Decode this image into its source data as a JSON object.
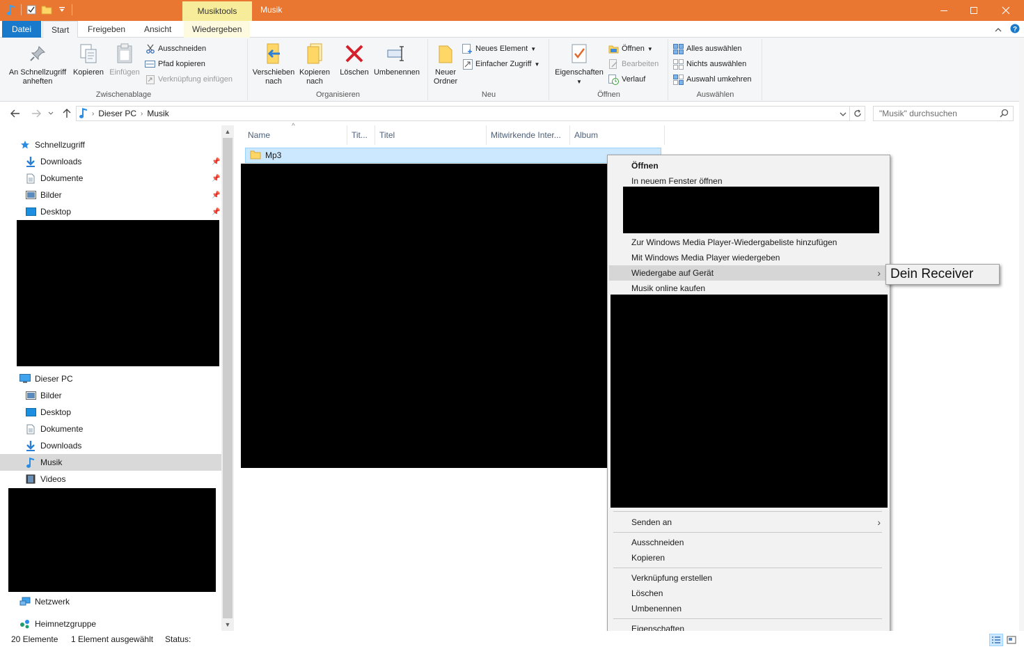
{
  "window": {
    "title": "Musik",
    "contextual_tab_header": "Musiktools",
    "accent": "#e97631",
    "file_tab_color": "#1979ca"
  },
  "ribbon_tabs": [
    "Datei",
    "Start",
    "Freigeben",
    "Ansicht",
    "Wiedergeben"
  ],
  "ribbon": {
    "clipboard": {
      "label": "Zwischenablage",
      "pin": "An Schnellzugriff\nanheften",
      "copy": "Kopieren",
      "paste": "Einfügen",
      "cut": "Ausschneiden",
      "copy_path": "Pfad kopieren",
      "paste_shortcut": "Verknüpfung einfügen"
    },
    "organize": {
      "label": "Organisieren",
      "move": "Verschieben\nnach",
      "copy_to": "Kopieren\nnach",
      "delete": "Löschen",
      "rename": "Umbenennen"
    },
    "new": {
      "label": "Neu",
      "new_folder": "Neuer\nOrdner",
      "new_item": "Neues Element",
      "easy_access": "Einfacher Zugriff"
    },
    "open": {
      "label": "Öffnen",
      "properties": "Eigenschaften",
      "open": "Öffnen",
      "edit": "Bearbeiten",
      "history": "Verlauf"
    },
    "select": {
      "label": "Auswählen",
      "select_all": "Alles auswählen",
      "select_none": "Nichts auswählen",
      "invert": "Auswahl umkehren"
    }
  },
  "address": {
    "crumbs": [
      "Dieser PC",
      "Musik"
    ],
    "search_placeholder": "\"Musik\" durchsuchen"
  },
  "nav": {
    "quick_access": "Schnellzugriff",
    "quick_items": [
      "Downloads",
      "Dokumente",
      "Bilder",
      "Desktop"
    ],
    "this_pc": "Dieser PC",
    "pc_items": [
      "Bilder",
      "Desktop",
      "Dokumente",
      "Downloads",
      "Musik",
      "Videos"
    ],
    "network": "Netzwerk",
    "homegroup": "Heimnetzgruppe"
  },
  "columns": [
    "Name",
    "Tit...",
    "Titel",
    "Mitwirkende Inter...",
    "Album"
  ],
  "files": [
    {
      "name": "Mp3"
    }
  ],
  "status": {
    "count": "20 Elemente",
    "selected": "1 Element ausgewählt",
    "status_label": "Status:"
  },
  "context_menu": {
    "open": "Öffnen",
    "open_new_window": "In neuem Fenster öffnen",
    "add_to_playlist": "Zur Windows Media Player-Wiedergabeliste hinzufügen",
    "play_wmp": "Mit Windows Media Player wiedergeben",
    "cast_to_device": "Wiedergabe auf Gerät",
    "buy_music": "Musik online kaufen",
    "send_to": "Senden an",
    "cut": "Ausschneiden",
    "copy": "Kopieren",
    "create_shortcut": "Verknüpfung erstellen",
    "delete": "Löschen",
    "rename": "Umbenennen",
    "properties": "Eigenschaften",
    "submenu_item": "Dein Receiver"
  }
}
